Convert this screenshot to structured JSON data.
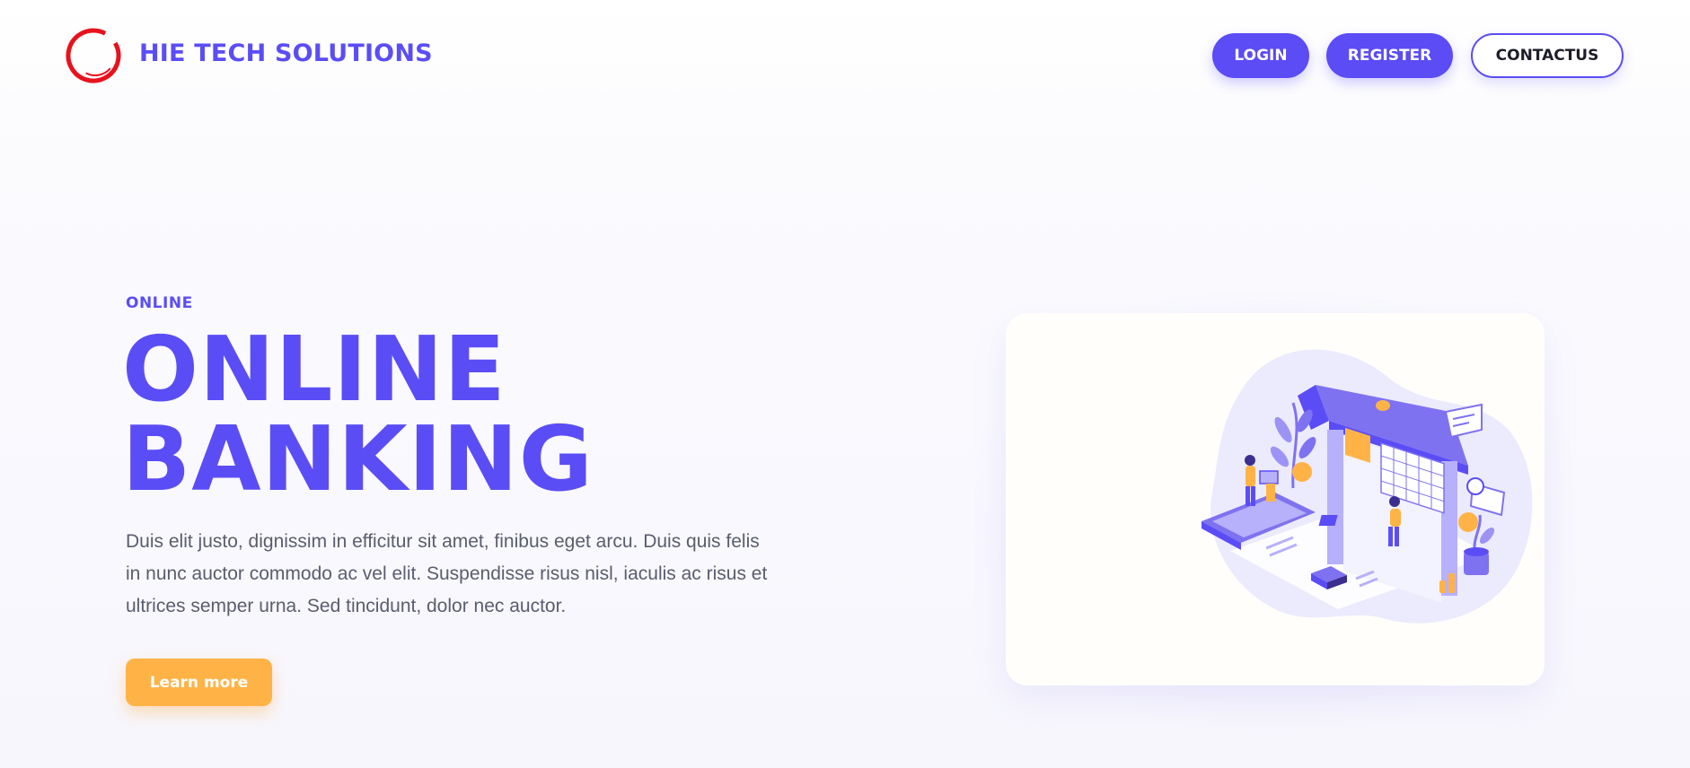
{
  "header": {
    "brand": "HIE TECH SOLUTIONS",
    "nav": {
      "login": "LOGIN",
      "register": "REGISTER",
      "contact": "CONTACTUS"
    }
  },
  "hero": {
    "eyebrow": "ONLINE",
    "headline_line1": "ONLINE",
    "headline_line2": "BANKING",
    "description": "Duis elit justo, dignissim in efficitur sit amet, finibus eget arcu. Duis quis felis in nunc auctor commodo ac vel elit. Suspendisse risus nisl, iaculis ac risus et ultrices semper urna. Sed tincidunt, dolor nec auctor.",
    "cta": "Learn more"
  },
  "illustration": {
    "icon": "online-banking-isometric-illustration"
  },
  "colors": {
    "brand": "#5b4df5",
    "accent": "#ffb347",
    "logo_ring": "#e8121c",
    "text_muted": "#5a5d6e"
  }
}
